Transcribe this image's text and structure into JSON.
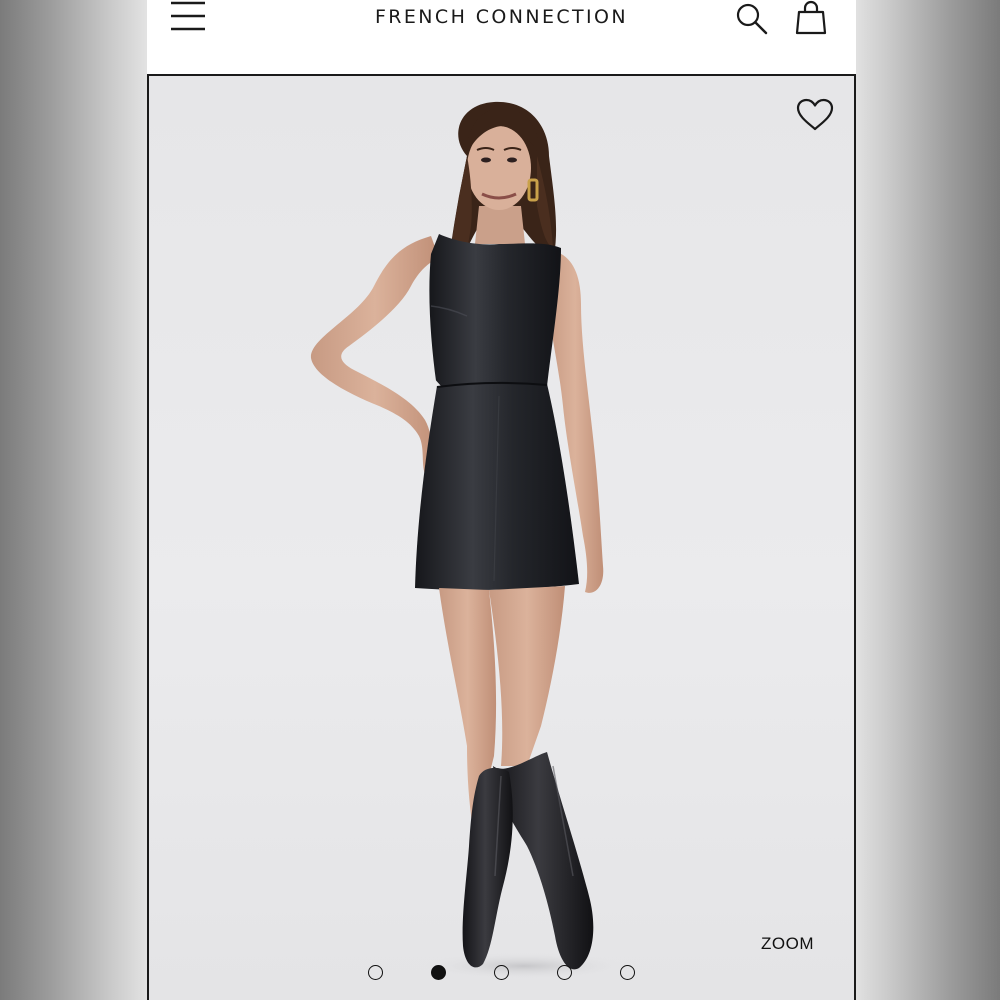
{
  "header": {
    "brand": "FRENCH CONNECTION",
    "icons": [
      "menu-icon",
      "search-icon",
      "shopping-bag-icon"
    ]
  },
  "gallery": {
    "wishlist_icon": "heart-icon",
    "zoom_label": "ZOOM",
    "image_alt": "Model wearing black faux leather sleeveless mini dress with black knee-high boots",
    "slide_count": 5,
    "active_slide": 2
  },
  "colors": {
    "text": "#1a1a1a",
    "background": "#ffffff",
    "image_backdrop": "#e8e8ea"
  }
}
